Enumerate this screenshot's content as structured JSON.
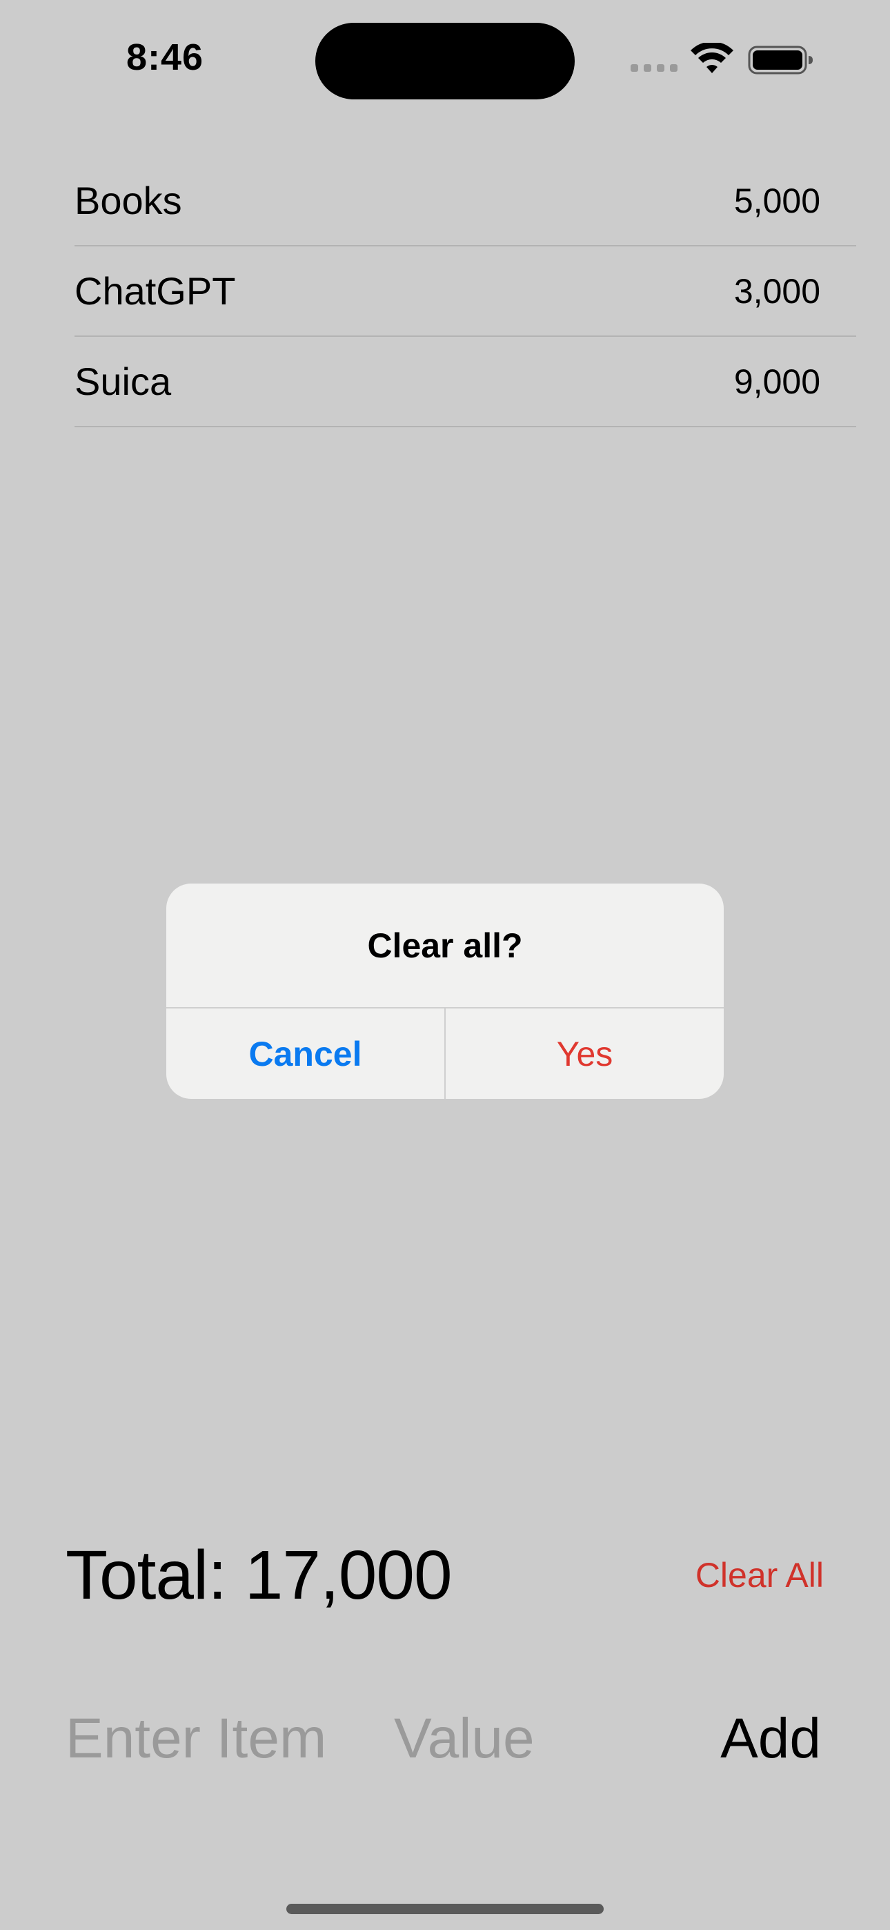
{
  "status_bar": {
    "time": "8:46"
  },
  "list": {
    "items": [
      {
        "name": "Books",
        "value": "5,000"
      },
      {
        "name": "ChatGPT",
        "value": "3,000"
      },
      {
        "name": "Suica",
        "value": "9,000"
      }
    ]
  },
  "alert": {
    "title": "Clear all?",
    "cancel_label": "Cancel",
    "confirm_label": "Yes"
  },
  "footer": {
    "total_label": "Total: 17,000",
    "clear_all_label": "Clear All",
    "item_placeholder": "Enter Item",
    "value_placeholder": "Value",
    "add_label": "Add"
  },
  "colors": {
    "background": "#cccccc",
    "accent_blue": "#0a7af0",
    "destructive_red": "#e0382f"
  },
  "icons": [
    "wifi-icon",
    "battery-icon",
    "cellular-signal-icon"
  ]
}
